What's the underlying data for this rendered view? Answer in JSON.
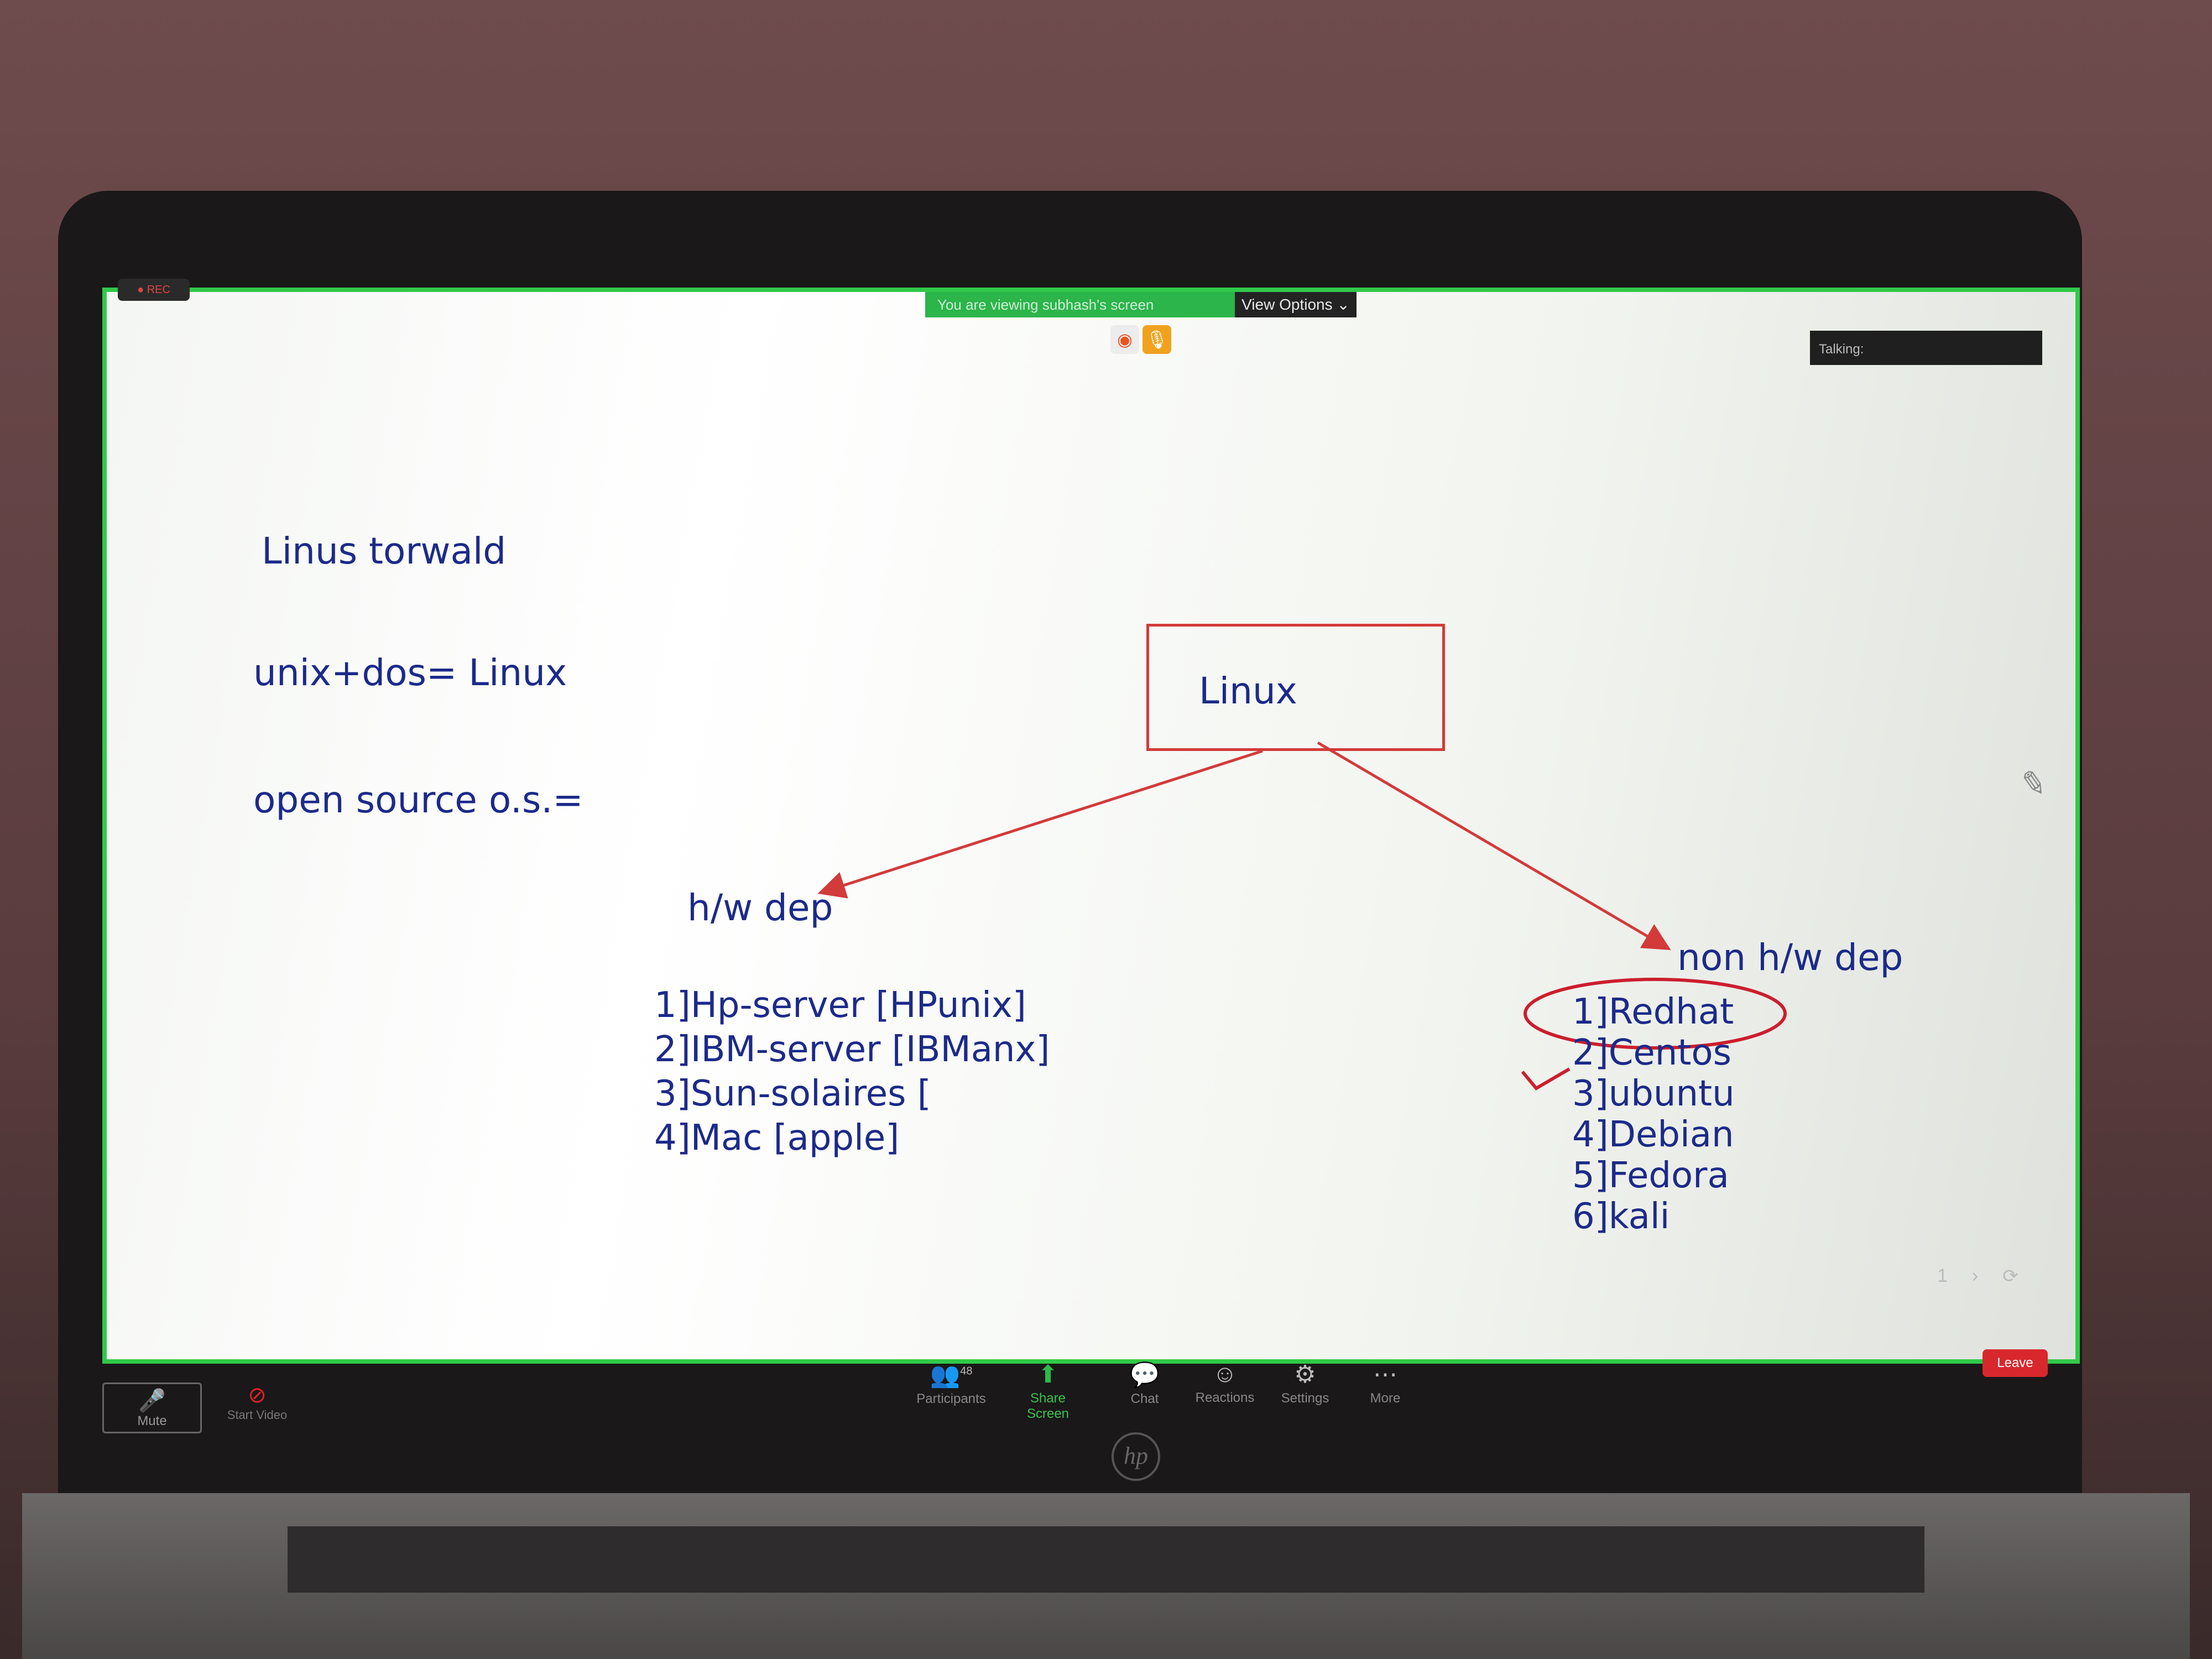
{
  "meeting": {
    "rec_label": "REC",
    "share_banner": "You are viewing subhash's screen",
    "view_options": "View Options",
    "talking_label": "Talking:"
  },
  "slide": {
    "line1": "Linus torwald",
    "line2": "unix+dos=  Linux",
    "line3": "open source  o.s.=",
    "root_box": "Linux",
    "left_branch_title": "h/w dep",
    "left_items": [
      "1]Hp-server [HPunix]",
      "2]IBM-server [IBManx]",
      "3]Sun-solaires [",
      "4]Mac [apple]"
    ],
    "right_branch_title": "non h/w dep",
    "right_items": [
      "1]Redhat",
      "2]Centos",
      "3]ubuntu",
      "4]Debian",
      "5]Fedora",
      "6]kali"
    ]
  },
  "nav": {
    "page": "1"
  },
  "toolbar": {
    "mute": "Mute",
    "start_video": "Start Video",
    "participants": "Participants",
    "participants_count": "48",
    "share_screen": "Share Screen",
    "chat": "Chat",
    "reactions": "Reactions",
    "settings": "Settings",
    "more": "More",
    "leave": "Leave"
  },
  "icons": [
    "firefox-icon",
    "mic-icon",
    "pencil-icon",
    "participants-icon",
    "share-screen-icon",
    "chat-icon",
    "reactions-icon",
    "settings-icon",
    "more-icon",
    "video-off-icon"
  ],
  "colors": {
    "accent_green": "#2bb54a",
    "slide_text": "#1c2a8a",
    "diagram_red": "#d33a3a",
    "leave_red": "#d8282d"
  }
}
